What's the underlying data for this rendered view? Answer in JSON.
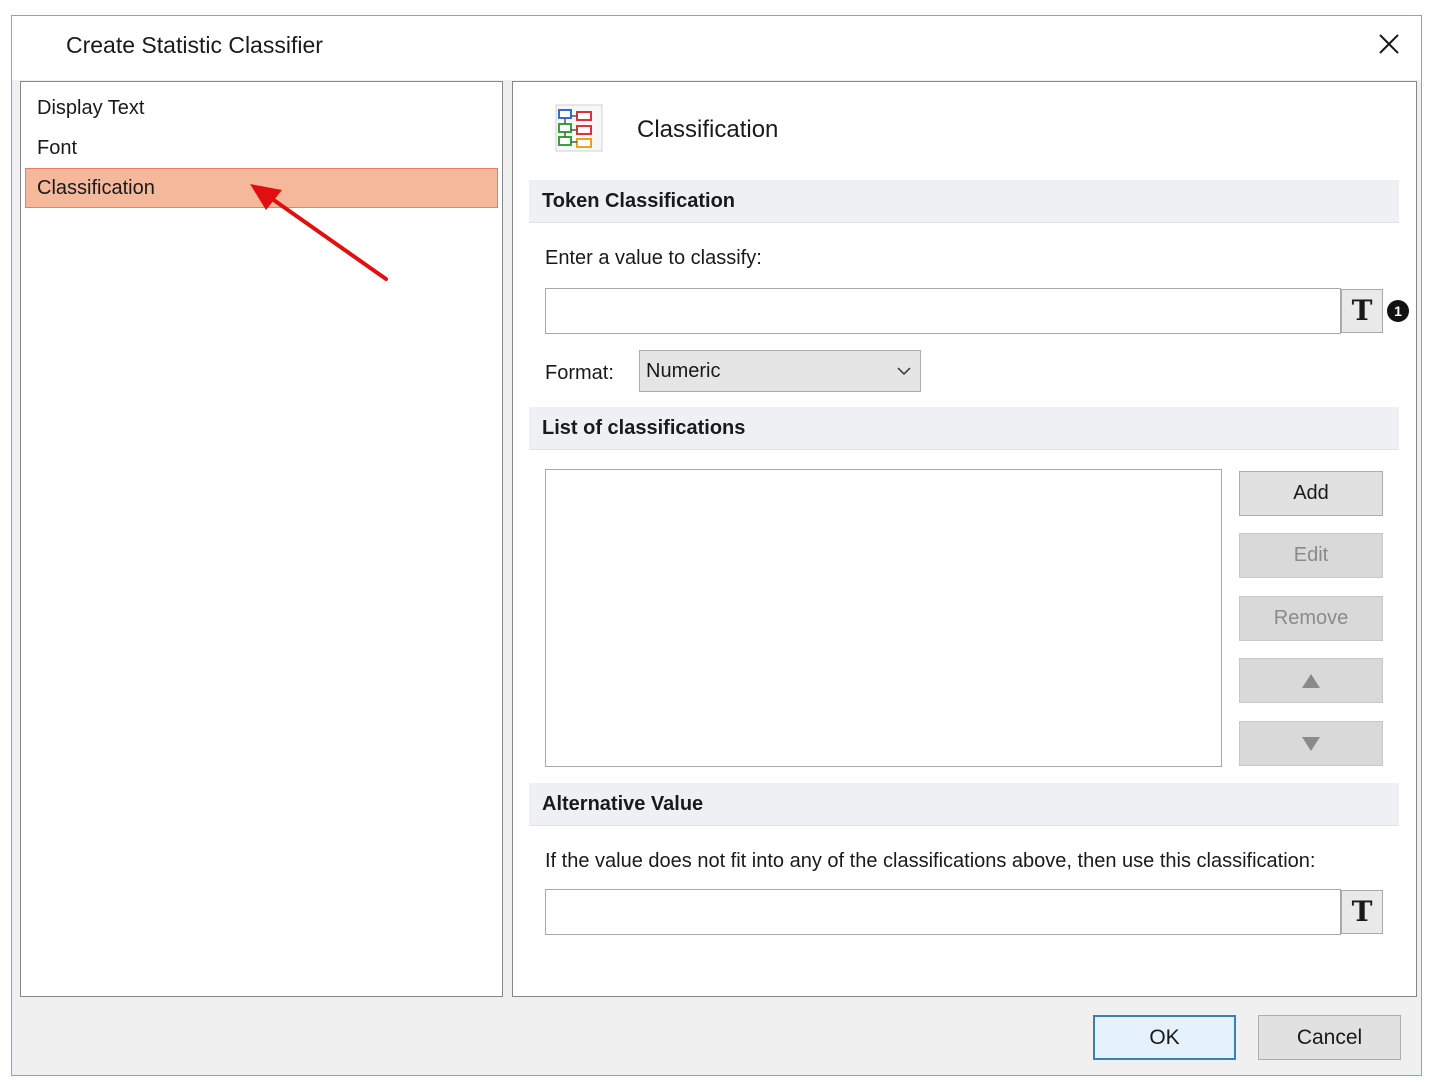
{
  "window": {
    "title": "Create Statistic Classifier"
  },
  "sidebar": {
    "items": [
      {
        "label": "Display Text"
      },
      {
        "label": "Font"
      },
      {
        "label": "Classification"
      }
    ],
    "selected": "Classification"
  },
  "page": {
    "title": "Classification",
    "icon": "classification-diagram-icon"
  },
  "token_classification": {
    "header": "Token Classification",
    "prompt": "Enter a value to classify:",
    "value": "",
    "text_button": "T",
    "info_badge": "1",
    "format_label": "Format:",
    "format_value": "Numeric"
  },
  "classifications": {
    "header": "List of classifications",
    "items": [],
    "add_label": "Add",
    "edit_label": "Edit",
    "remove_label": "Remove",
    "move_up_icon": "up-triangle-icon",
    "move_down_icon": "down-triangle-icon"
  },
  "alternative": {
    "header": "Alternative Value",
    "prompt": "If the value does not fit into any of the classifications above, then use this classification:",
    "value": "",
    "text_button": "T"
  },
  "footer": {
    "ok_label": "OK",
    "cancel_label": "Cancel"
  },
  "colors": {
    "selected_item_bg": "#f5b89a",
    "selected_item_border": "#e8805a",
    "annotation_arrow": "#e01010",
    "default_button_border": "#3c7fb1"
  }
}
